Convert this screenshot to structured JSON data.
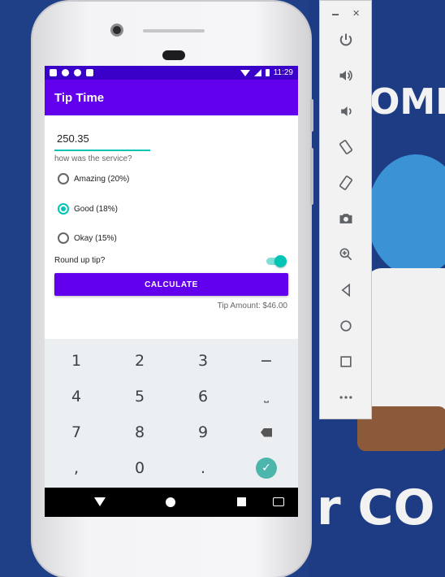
{
  "app": {
    "title": "Tip Time",
    "status_time": "11:29"
  },
  "form": {
    "cost_value": "250.35",
    "service_question": "how was the service?",
    "options": [
      {
        "label": "Amazing (20%)",
        "checked": false
      },
      {
        "label": "Good (18%)",
        "checked": true
      },
      {
        "label": "Okay (15%)",
        "checked": false
      }
    ],
    "round_up_label": "Round up tip?",
    "round_up_on": true,
    "calculate_label": "CALCULATE",
    "tip_amount_text": "Tip Amount: $46.00"
  },
  "keyboard": {
    "keys": [
      "1",
      "2",
      "3",
      "−",
      "4",
      "5",
      "6",
      "⎵",
      "7",
      "8",
      "9",
      "⌫",
      ",",
      "0",
      ".",
      "✓"
    ]
  },
  "emulator_toolbar": {
    "buttons": [
      "power-icon",
      "volume-up-icon",
      "volume-down-icon",
      "rotate-left-icon",
      "rotate-right-icon",
      "camera-icon",
      "zoom-icon",
      "back-icon",
      "home-icon",
      "overview-icon",
      "more-icon"
    ]
  },
  "wallpaper": {
    "text_top": "OME",
    "text_bottom": "r CO"
  },
  "colors": {
    "primary": "#6200ee",
    "status_bar": "#3a00c9",
    "accent": "#00c4b4",
    "desktop_bg": "#1f3f86"
  }
}
